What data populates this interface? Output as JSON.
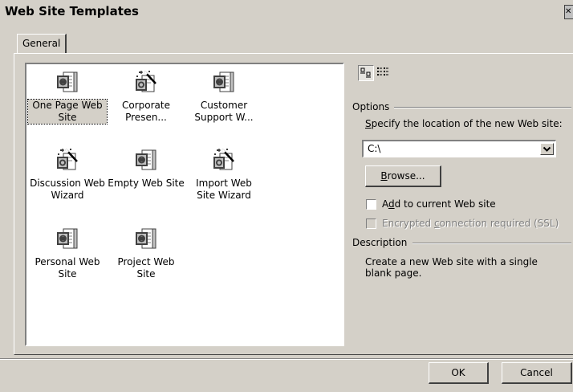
{
  "window": {
    "title": "Web Site Templates"
  },
  "tabs": [
    {
      "label": "General",
      "active": true
    }
  ],
  "templates": [
    {
      "label": "One Page Web Site",
      "icon": "web-page-icon",
      "selected": true
    },
    {
      "label": "Corporate Presen...",
      "icon": "wizard-icon",
      "selected": false
    },
    {
      "label": "Customer Support W...",
      "icon": "web-page-icon",
      "selected": false
    },
    {
      "label": "Discussion Web Wizard",
      "icon": "wizard-icon",
      "selected": false
    },
    {
      "label": "Empty Web Site",
      "icon": "web-page-icon",
      "selected": false
    },
    {
      "label": "Import Web Site Wizard",
      "icon": "wizard-icon",
      "selected": false
    },
    {
      "label": "Personal Web Site",
      "icon": "web-page-icon",
      "selected": false
    },
    {
      "label": "Project Web Site",
      "icon": "web-page-icon",
      "selected": false
    }
  ],
  "view_toggle": {
    "large_icons": "large-icons-view-icon",
    "details": "details-view-icon",
    "active": "large_icons"
  },
  "options": {
    "group_label": "Options",
    "location_prompt_prefix": "",
    "location_prompt_accel": "S",
    "location_prompt_rest": "pecify the location of the new Web site:",
    "location_value": "C:\\",
    "browse_accel": "B",
    "browse_rest": "rowse...",
    "add_current_pre": "A",
    "add_current_accel": "d",
    "add_current_rest": "d to current Web site",
    "add_current_checked": false,
    "encrypted_pre": "Encrypted ",
    "encrypted_accel": "c",
    "encrypted_rest": "onnection required (SSL)",
    "encrypted_checked": false,
    "encrypted_enabled": false
  },
  "description": {
    "group_label": "Description",
    "text": "Create a new Web site with a single blank page."
  },
  "buttons": {
    "ok": "OK",
    "cancel": "Cancel"
  },
  "colors": {
    "face": "#d4d0c8",
    "shadow": "#808080",
    "dark_shadow": "#404040",
    "highlight": "#ffffff"
  }
}
